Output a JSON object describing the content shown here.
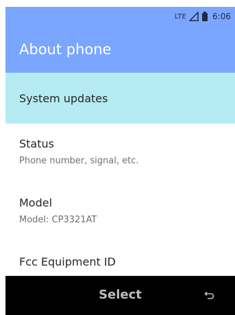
{
  "status_bar": {
    "network": "LTE",
    "time": "6:06",
    "icons": [
      "signal-icon",
      "battery-icon"
    ]
  },
  "app_bar": {
    "title": "About phone",
    "color": "#7aa6ff"
  },
  "list": {
    "items": [
      {
        "title": "System updates",
        "subtitle": "",
        "highlighted": true
      },
      {
        "title": "Status",
        "subtitle": "Phone number, signal, etc.",
        "highlighted": false
      },
      {
        "title": "Model",
        "subtitle": "Model: CP3321AT",
        "highlighted": false
      },
      {
        "title": "Fcc Equipment ID",
        "subtitle": "",
        "highlighted": false
      }
    ],
    "highlight_color": "#b6ebf4"
  },
  "softkeys": {
    "center_label": "Select",
    "right_icon": "back-icon"
  }
}
